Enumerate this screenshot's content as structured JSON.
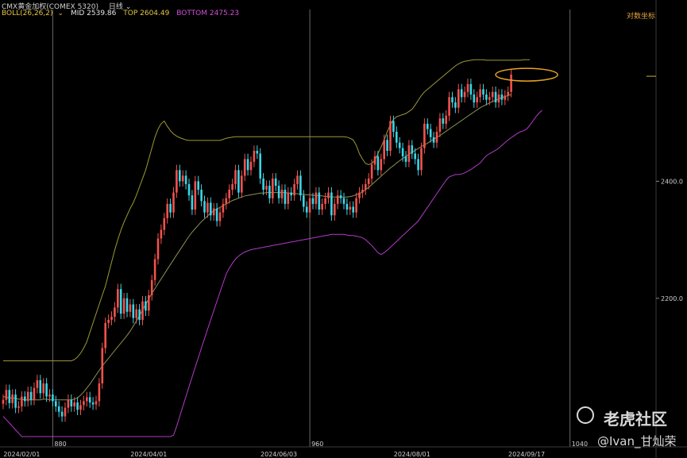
{
  "header": {
    "symbol_title": "CMX黄金加权(COMEX 5320)",
    "period": "日线",
    "indicator": "BOLL(26,26,2)",
    "mid": "MID 2539.86",
    "top": "TOP 2604.49",
    "bottom": "BOTTOM 2475.23",
    "log_axis_label": "对数坐标"
  },
  "watermark": {
    "site": "老虎社区",
    "user": "@Ivan_甘灿荣"
  },
  "colors": {
    "up": "#f2524d",
    "down": "#39d6e8",
    "mid": "#8f8f4f",
    "top": "#9d9a34",
    "bottom": "#b03cc6",
    "grid": "#6a6a6a",
    "highlight": "#e8a423",
    "mid_text": "#e6e6e6",
    "top_text": "#e6c642",
    "bottom_text": "#d24fd8"
  },
  "chart_data": {
    "type": "candlestick",
    "y_scale": "log",
    "ylim": [
      1985,
      2695
    ],
    "y_ticks": [
      {
        "value": 2200,
        "label": "2200.0"
      },
      {
        "value": 2400,
        "label": "2400.0"
      }
    ],
    "x_count": 175,
    "date_labels": [
      {
        "index": 6,
        "label": "2024/02/01"
      },
      {
        "index": 47,
        "label": "2024/04/01"
      },
      {
        "index": 89,
        "label": "2024/06/03"
      },
      {
        "index": 132,
        "label": "2024/08/01"
      },
      {
        "index": 169,
        "label": "2024/09/17"
      }
    ],
    "marker_lines": [
      {
        "index": 16,
        "label": "880"
      },
      {
        "index": 99,
        "label": "960"
      },
      {
        "index": 183,
        "label": "1040"
      }
    ],
    "last_close_tick": 2595,
    "highlight": {
      "index": 169,
      "value": 2598
    },
    "series": [
      {
        "name": "BOLL",
        "kind": "ohlc",
        "closes": [
          2040,
          2055,
          2035,
          2048,
          2028,
          2030,
          2045,
          2038,
          2052,
          2040,
          2058,
          2070,
          2050,
          2065,
          2045,
          2048,
          2038,
          2030,
          2022,
          2015,
          2028,
          2040,
          2030,
          2036,
          2025,
          2032,
          2038,
          2044,
          2036,
          2033,
          2038,
          2065,
          2120,
          2160,
          2165,
          2170,
          2185,
          2215,
          2175,
          2200,
          2178,
          2190,
          2168,
          2182,
          2165,
          2195,
          2180,
          2205,
          2230,
          2265,
          2300,
          2315,
          2335,
          2360,
          2345,
          2380,
          2420,
          2400,
          2410,
          2395,
          2375,
          2350,
          2400,
          2385,
          2365,
          2345,
          2362,
          2340,
          2352,
          2330,
          2345,
          2360,
          2370,
          2385,
          2395,
          2420,
          2380,
          2410,
          2440,
          2420,
          2435,
          2455,
          2450,
          2405,
          2385,
          2392,
          2370,
          2405,
          2392,
          2370,
          2385,
          2360,
          2380,
          2375,
          2395,
          2410,
          2375,
          2355,
          2345,
          2370,
          2360,
          2380,
          2350,
          2360,
          2370,
          2380,
          2340,
          2360,
          2375,
          2370,
          2360,
          2350,
          2355,
          2345,
          2370,
          2380,
          2385,
          2395,
          2405,
          2430,
          2445,
          2420,
          2440,
          2475,
          2455,
          2510,
          2490,
          2470,
          2460,
          2445,
          2435,
          2465,
          2450,
          2440,
          2420,
          2460,
          2505,
          2495,
          2480,
          2470,
          2490,
          2515,
          2505,
          2520,
          2555,
          2545,
          2535,
          2570,
          2555,
          2565,
          2580,
          2560,
          2545,
          2555,
          2570,
          2560,
          2550,
          2555,
          2565,
          2545,
          2560,
          2550,
          2558,
          2565,
          2598
        ],
        "band": {
          "mid": [
            2045,
            2044,
            2043,
            2043,
            2042,
            2041,
            2041,
            2040,
            2040,
            2040,
            2040,
            2040,
            2040,
            2041,
            2041,
            2040,
            2040,
            2040,
            2040,
            2040,
            2040,
            2040,
            2040,
            2041,
            2043,
            2047,
            2052,
            2058,
            2064,
            2071,
            2078,
            2085,
            2092,
            2098,
            2104,
            2110,
            2116,
            2122,
            2128,
            2134,
            2140,
            2147,
            2155,
            2163,
            2172,
            2181,
            2190,
            2199,
            2208,
            2216,
            2224,
            2232,
            2240,
            2248,
            2256,
            2264,
            2272,
            2280,
            2288,
            2296,
            2304,
            2311,
            2317,
            2323,
            2329,
            2334,
            2339,
            2344,
            2348,
            2351,
            2354,
            2357,
            2360,
            2363,
            2366,
            2368,
            2370,
            2372,
            2374,
            2375,
            2376,
            2377,
            2378,
            2379,
            2379,
            2380,
            2380,
            2380,
            2380,
            2380,
            2380,
            2380,
            2379,
            2379,
            2378,
            2378,
            2377,
            2377,
            2376,
            2376,
            2375,
            2375,
            2374,
            2374,
            2373,
            2373,
            2372,
            2372,
            2372,
            2372,
            2372,
            2372,
            2373,
            2374,
            2376,
            2378,
            2381,
            2385,
            2389,
            2394,
            2399,
            2404,
            2409,
            2414,
            2419,
            2424,
            2428,
            2433,
            2437,
            2441,
            2445,
            2449,
            2452,
            2456,
            2459,
            2463,
            2466,
            2469,
            2473,
            2476,
            2480,
            2483,
            2487,
            2491,
            2495,
            2499,
            2503,
            2507,
            2511,
            2515,
            2519,
            2523,
            2527,
            2531,
            2535,
            2538,
            2541,
            2544,
            2547,
            2549,
            2552,
            2554,
            2556,
            2558,
            2560
          ],
          "top": [
            2100,
            2100,
            2100,
            2100,
            2100,
            2100,
            2100,
            2100,
            2100,
            2100,
            2100,
            2100,
            2100,
            2100,
            2100,
            2100,
            2100,
            2100,
            2100,
            2100,
            2100,
            2100,
            2100,
            2102,
            2106,
            2112,
            2120,
            2130,
            2145,
            2160,
            2175,
            2190,
            2205,
            2220,
            2240,
            2260,
            2280,
            2298,
            2314,
            2328,
            2340,
            2352,
            2362,
            2375,
            2390,
            2405,
            2420,
            2440,
            2460,
            2480,
            2495,
            2505,
            2510,
            2500,
            2492,
            2486,
            2482,
            2479,
            2477,
            2475,
            2474,
            2474,
            2474,
            2474,
            2474,
            2474,
            2474,
            2474,
            2474,
            2474,
            2474,
            2476,
            2478,
            2479,
            2480,
            2481,
            2481,
            2481,
            2481,
            2481,
            2481,
            2481,
            2481,
            2481,
            2481,
            2481,
            2481,
            2481,
            2481,
            2481,
            2481,
            2481,
            2481,
            2481,
            2481,
            2481,
            2481,
            2481,
            2481,
            2481,
            2481,
            2481,
            2481,
            2481,
            2481,
            2481,
            2481,
            2481,
            2481,
            2481,
            2481,
            2480,
            2478,
            2475,
            2465,
            2450,
            2440,
            2432,
            2430,
            2432,
            2438,
            2450,
            2462,
            2475,
            2490,
            2503,
            2513,
            2518,
            2520,
            2522,
            2524,
            2528,
            2532,
            2540,
            2549,
            2558,
            2565,
            2570,
            2575,
            2580,
            2585,
            2590,
            2595,
            2600,
            2605,
            2610,
            2615,
            2619,
            2622,
            2624,
            2625,
            2626,
            2627,
            2627,
            2627,
            2627,
            2626,
            2626,
            2626,
            2626,
            2626,
            2626,
            2626,
            2626,
            2626,
            2626,
            2626,
            2626,
            2627,
            2627,
            2627
          ],
          "bottom": [
            2015,
            2010,
            2005,
            2000,
            1995,
            1990,
            1985,
            1985,
            1985,
            1985,
            1985,
            1985,
            1985,
            1985,
            1985,
            1985,
            1985,
            1985,
            1985,
            1985,
            1985,
            1985,
            1985,
            1985,
            1985,
            1985,
            1985,
            1985,
            1985,
            1985,
            1985,
            1985,
            1985,
            1985,
            1985,
            1985,
            1985,
            1985,
            1985,
            1985,
            1985,
            1985,
            1985,
            1985,
            1985,
            1985,
            1985,
            1985,
            1985,
            1985,
            1985,
            1985,
            1985,
            1985,
            1985,
            1987,
            2000,
            2015,
            2030,
            2045,
            2060,
            2075,
            2090,
            2105,
            2120,
            2135,
            2150,
            2165,
            2180,
            2195,
            2210,
            2225,
            2240,
            2250,
            2258,
            2265,
            2270,
            2274,
            2277,
            2279,
            2281,
            2282,
            2283,
            2284,
            2285,
            2286,
            2287,
            2288,
            2289,
            2290,
            2291,
            2292,
            2293,
            2294,
            2295,
            2296,
            2297,
            2298,
            2299,
            2300,
            2301,
            2302,
            2303,
            2304,
            2305,
            2306,
            2307,
            2307,
            2307,
            2307,
            2307,
            2306,
            2305,
            2305,
            2304,
            2303,
            2301,
            2298,
            2293,
            2288,
            2282,
            2276,
            2273,
            2276,
            2280,
            2285,
            2290,
            2295,
            2300,
            2305,
            2310,
            2315,
            2320,
            2325,
            2330,
            2338,
            2346,
            2354,
            2362,
            2370,
            2378,
            2386,
            2394,
            2402,
            2408,
            2410,
            2412,
            2412,
            2413,
            2415,
            2418,
            2421,
            2425,
            2429,
            2433,
            2440,
            2446,
            2450,
            2453,
            2456,
            2460,
            2465,
            2470,
            2475,
            2479,
            2483,
            2487,
            2490,
            2492,
            2495,
            2502,
            2510,
            2518,
            2525,
            2530
          ]
        }
      }
    ]
  }
}
